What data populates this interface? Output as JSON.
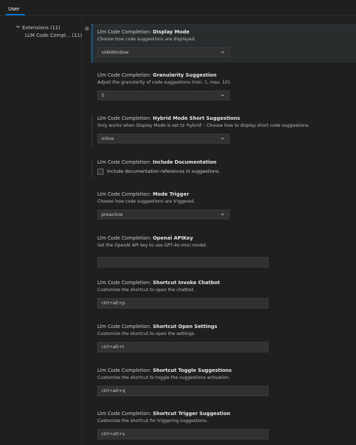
{
  "tabs": {
    "user": "User"
  },
  "sidebar": {
    "items": [
      {
        "label": "Extensions (11)"
      },
      {
        "label": "LLM Code Compl... (11)"
      }
    ]
  },
  "settings": {
    "display_mode": {
      "prefix": "Llm Code Completion: ",
      "name": "Display Mode",
      "desc": "Choose how code suggestions are displayed.",
      "value": "sideWindow"
    },
    "granularity": {
      "prefix": "Llm Code Completion: ",
      "name": "Granularity Suggestion",
      "desc": "Adjust the granularity of code suggestions (min. 1, max. 10).",
      "value": "5"
    },
    "hybrid": {
      "prefix": "Llm Code Completion: ",
      "name": "Hybrid Mode Short Suggestions",
      "desc": "Only works when Display Mode is set to 'hybrid' - Choose how to display short code suggestions.",
      "value": "inline"
    },
    "include_doc": {
      "prefix": "Llm Code Completion: ",
      "name": "Include Documentation",
      "checkbox_label": "Include documentation references in suggestions."
    },
    "mode_trigger": {
      "prefix": "Llm Code Completion: ",
      "name": "Mode Trigger",
      "desc": "Choose how code suggestions are triggered.",
      "value": "proactive"
    },
    "openai_key": {
      "prefix": "Llm Code Completion: ",
      "name": "Openai APIKey",
      "desc": "Set the OpenAI API key to use GPT-4o-mini model.",
      "value": ""
    },
    "shortcut_chatbot": {
      "prefix": "Llm Code Completion: ",
      "name": "Shortcut Invoke Chatbot",
      "desc": "Customize the shortcut to open the chatbot.",
      "value": "ctrl+alt+p"
    },
    "shortcut_settings": {
      "prefix": "Llm Code Completion: ",
      "name": "Shortcut Open Settings",
      "desc": "Customize the shortcut to open the settings.",
      "value": "ctrl+alt+t"
    },
    "shortcut_toggle": {
      "prefix": "Llm Code Completion: ",
      "name": "Shortcut Toggle Suggestions",
      "desc": "Customize the shortcut to toggle the suggestions activation.",
      "value": "ctrl+alt+q"
    },
    "shortcut_trigger": {
      "prefix": "Llm Code Completion: ",
      "name": "Shortcut Trigger Suggestion",
      "desc": "Customize the shortcut for triggering suggestions.",
      "value": "ctrl+alt+s"
    }
  },
  "colors": {
    "background": "#1f1f1f",
    "accent": "#0078d4",
    "input_background": "#313131",
    "focused_row": "#2a2d2e"
  },
  "icons": {
    "tree_expand": "chevron-down-icon",
    "gear": "gear-icon",
    "dropdown": "chevron-down-icon"
  }
}
